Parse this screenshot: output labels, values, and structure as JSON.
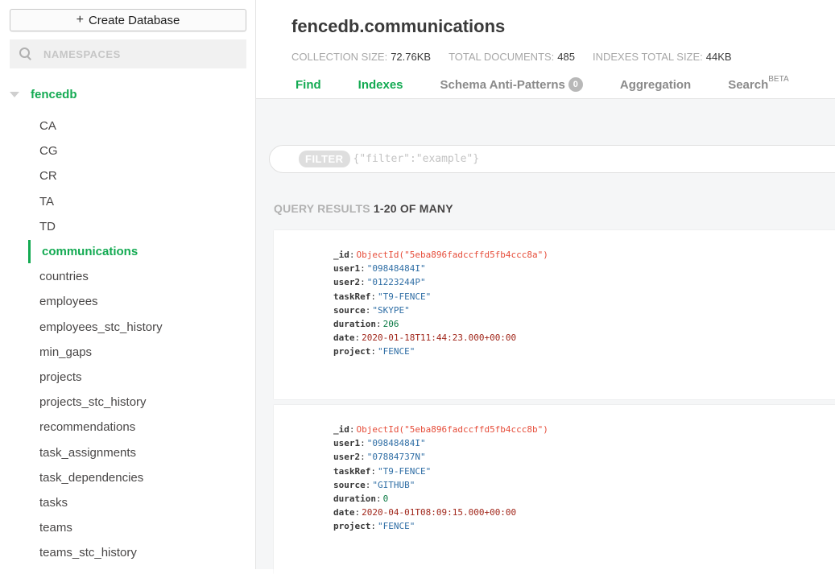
{
  "sidebar": {
    "create_label": "Create Database",
    "search_placeholder": "NAMESPACES",
    "database": "fencedb",
    "collections": [
      "CA",
      "CG",
      "CR",
      "TA",
      "TD",
      "communications",
      "countries",
      "employees",
      "employees_stc_history",
      "min_gaps",
      "projects",
      "projects_stc_history",
      "recommendations",
      "task_assignments",
      "task_dependencies",
      "tasks",
      "teams",
      "teams_stc_history"
    ],
    "active_collection": "communications"
  },
  "header": {
    "namespace": "fencedb.communications",
    "collection_size_label": "COLLECTION SIZE:",
    "collection_size": "72.76KB",
    "total_docs_label": "TOTAL DOCUMENTS:",
    "total_docs": "485",
    "indexes_size_label": "INDEXES TOTAL SIZE:",
    "indexes_size": "44KB",
    "tabs": [
      {
        "label": "Find"
      },
      {
        "label": "Indexes"
      },
      {
        "label": "Schema Anti-Patterns",
        "badge": "0"
      },
      {
        "label": "Aggregation"
      },
      {
        "label": "Search",
        "sup": "BETA"
      }
    ]
  },
  "filter": {
    "pill": "FILTER",
    "placeholder": "{\"filter\":\"example\"}"
  },
  "results": {
    "label": "QUERY RESULTS",
    "range": "1-20 OF MANY"
  },
  "documents": [
    {
      "_id": "ObjectId(\"5eba896fadccffd5fb4ccc8a\")",
      "user1": "\"09848484I\"",
      "user2": "\"01223244P\"",
      "taskRef": "\"T9-FENCE\"",
      "source": "\"SKYPE\"",
      "duration": "206",
      "date": "2020-01-18T11:44:23.000+00:00",
      "project": "\"FENCE\""
    },
    {
      "_id": "ObjectId(\"5eba896fadccffd5fb4ccc8b\")",
      "user1": "\"09848484I\"",
      "user2": "\"07884737N\"",
      "taskRef": "\"T9-FENCE\"",
      "source": "\"GITHUB\"",
      "duration": "0",
      "date": "2020-04-01T08:09:15.000+00:00",
      "project": "\"FENCE\""
    }
  ],
  "colors": {
    "accent_green": "#13aa52",
    "objectid": "#e64d3a",
    "string": "#2f6ea5",
    "number": "#0b7a44",
    "date": "#a1271b"
  }
}
